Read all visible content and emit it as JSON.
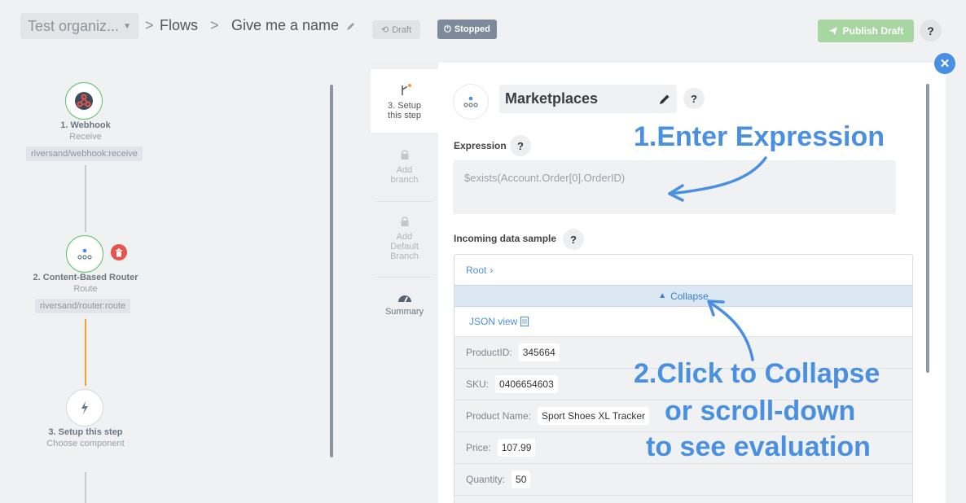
{
  "header": {
    "org_select": "Test organiz...",
    "sep": ">",
    "breadcrumb_flows": "Flows",
    "flow_name": "Give me a name",
    "draft_label": "Draft",
    "stopped_label": "Stopped",
    "publish_label": "Publish Draft",
    "help": "?"
  },
  "flow": {
    "steps": [
      {
        "title": "1. Webhook",
        "subtitle": "Receive",
        "tag": "riversand/webhook:receive"
      },
      {
        "title": "2. Content-Based Router",
        "subtitle": "Route",
        "tag": "riversand/router:route"
      },
      {
        "title": "3. Setup this step",
        "subtitle": "Choose component"
      }
    ]
  },
  "panel": {
    "tabs": [
      {
        "label": "3. Setup this step"
      },
      {
        "label": "Add branch"
      },
      {
        "label": "Add Default Branch"
      },
      {
        "label": "Summary"
      }
    ],
    "component_name": "Marketplaces",
    "help": "?",
    "expression_label": "Expression",
    "expression_value": "$exists(Account.Order[0].OrderID)",
    "incoming_label": "Incoming data sample",
    "root_label": "Root",
    "collapse_label": "Collapse",
    "json_view_label": "JSON view",
    "rows": [
      {
        "key": "ProductID:",
        "value": "345664"
      },
      {
        "key": "SKU:",
        "value": "0406654603"
      },
      {
        "key": "Product Name:",
        "value": "Sport Shoes XL Tracker"
      },
      {
        "key": "Price:",
        "value": "107.99"
      },
      {
        "key": "Quantity:",
        "value": "50"
      }
    ]
  },
  "annotations": {
    "step1": "1.Enter Expression",
    "step2_line1": "2.Click to Collapse",
    "step2_line2": "or scroll-down",
    "step2_line3": "to see evaluation"
  },
  "colors": {
    "accent": "#4a90e2",
    "publish": "#a7d6a3",
    "stopped": "#7d8a9a",
    "router_line": "#f0a030",
    "delete": "#e8544a"
  }
}
